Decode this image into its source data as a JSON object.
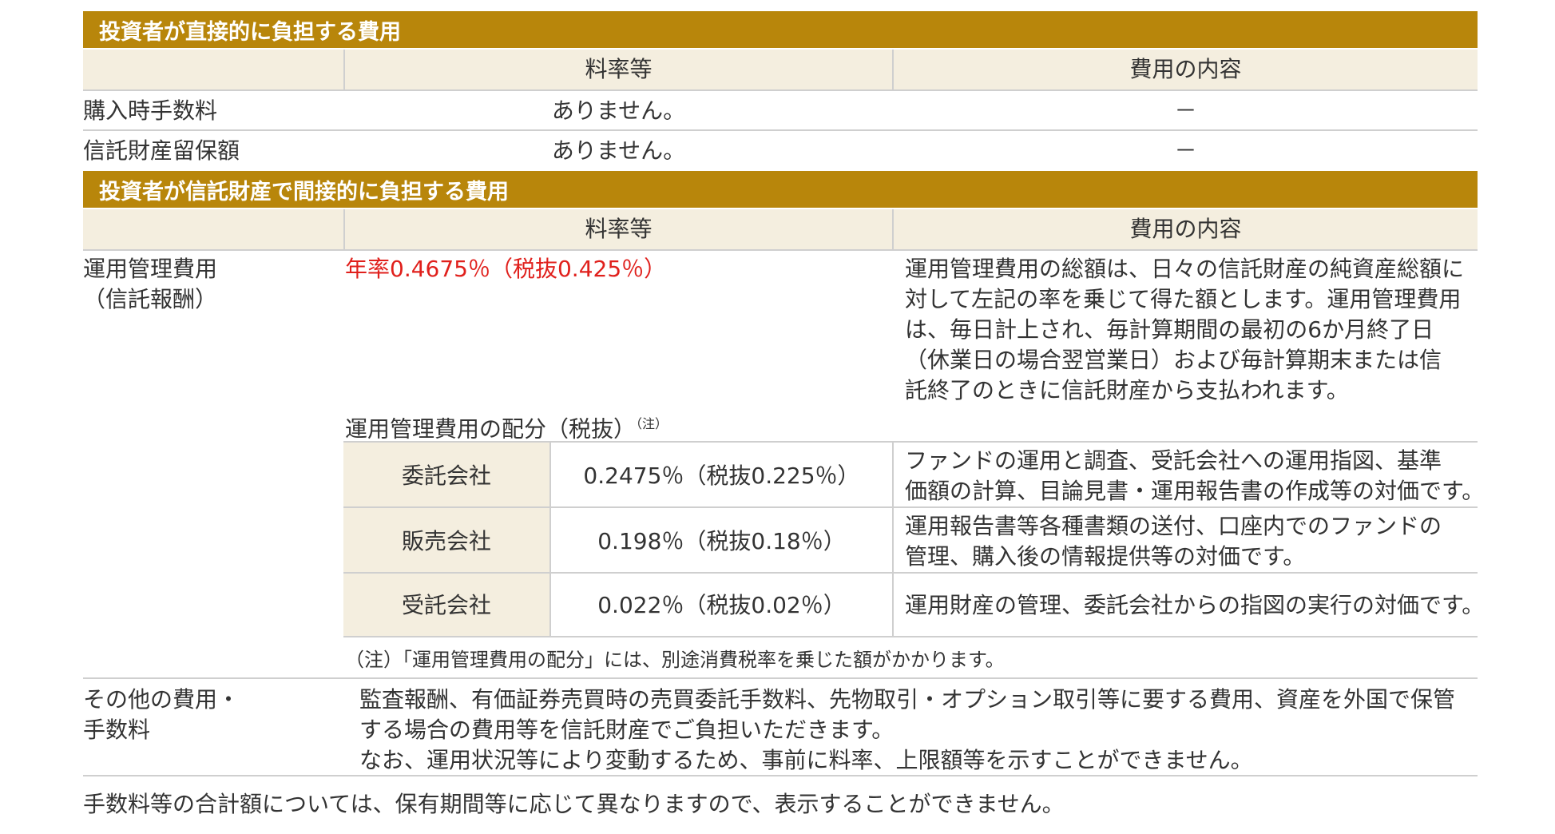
{
  "section1": {
    "title": "投資者が直接的に負担する費用",
    "col_rate": "料率等",
    "col_content": "費用の内容",
    "rows": [
      {
        "label": "購入時手数料",
        "rate": "ありません。",
        "content": "－"
      },
      {
        "label": "信託財産留保額",
        "rate": "ありません。",
        "content": "－"
      }
    ]
  },
  "section2": {
    "title": "投資者が信託財産で間接的に負担する費用",
    "col_rate": "料率等",
    "col_content": "費用の内容",
    "mgmt": {
      "label_line1": "運用管理費用",
      "label_line2": "（信託報酬）",
      "rate": "年率0.4675％（税抜0.425％）",
      "content_lines": [
        "運用管理費用の総額は、日々の信託財産の純資産総額に",
        "対して左記の率を乗じて得た額とします。運用管理費用",
        "は、毎日計上され、毎計算期間の最初の6か月終了日",
        "（休業日の場合翌営業日）および毎計算期末または信",
        "託終了のときに信託財産から支払われます。"
      ]
    },
    "allocation": {
      "title": "運用管理費用の配分（税抜）",
      "title_note": "（注）",
      "rows": [
        {
          "party": "委託会社",
          "rate": "0.2475％（税抜0.225％）",
          "content_lines": [
            "ファンドの運用と調査、受託会社への運用指図、基準",
            "価額の計算、目論見書・運用報告書の作成等の対価です。"
          ]
        },
        {
          "party": "販売会社",
          "rate": "0.198％（税抜0.18％）",
          "content_lines": [
            "運用報告書等各種書類の送付、口座内でのファンドの",
            "管理、購入後の情報提供等の対価です。"
          ]
        },
        {
          "party": "受託会社",
          "rate": "0.022％（税抜0.02％）",
          "content_lines": [
            "運用財産の管理、委託会社からの指図の実行の対価です。"
          ]
        }
      ],
      "note": "（注）「運用管理費用の配分」には、別途消費税率を乗じた額がかかります。"
    },
    "other": {
      "label_line1": "その他の費用・",
      "label_line2": "手数料",
      "content_lines": [
        "監査報酬、有価証券売買時の売買委託手数料、先物取引・オプション取引等に要する費用、資産を外国で保管",
        "する場合の費用等を信託財産でご負担いただきます。",
        "なお、運用状況等により変動するため、事前に料率、上限額等を示すことができません。"
      ]
    }
  },
  "footer_note": "手数料等の合計額については、保有期間等に応じて異なりますので、表示することができません。",
  "colors": {
    "band": "#b8860b",
    "header_bg": "#f4eedf",
    "accent_red": "#e0201c"
  }
}
